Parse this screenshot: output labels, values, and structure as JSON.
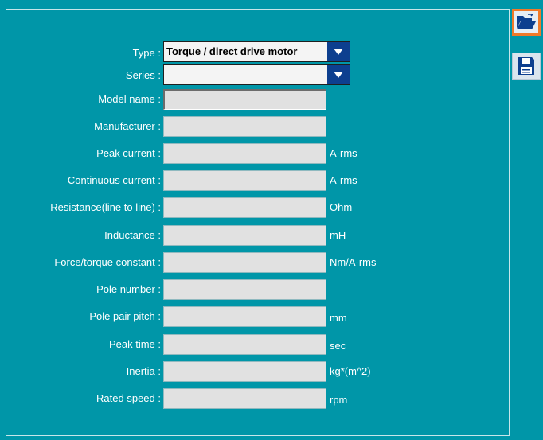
{
  "form": {
    "type": {
      "label": "Type :",
      "value": "Torque / direct drive motor"
    },
    "series": {
      "label": "Series :",
      "value": ""
    },
    "fields": [
      {
        "key": "model_name",
        "label": "Model name :",
        "value": "",
        "unit": ""
      },
      {
        "key": "manufacturer",
        "label": "Manufacturer :",
        "value": "",
        "unit": ""
      },
      {
        "key": "peak_current",
        "label": "Peak current :",
        "value": "",
        "unit": "A-rms"
      },
      {
        "key": "continuous_current",
        "label": "Continuous current :",
        "value": "",
        "unit": "A-rms"
      },
      {
        "key": "resistance",
        "label": "Resistance(line to line) :",
        "value": "",
        "unit": "Ohm"
      },
      {
        "key": "inductance",
        "label": "Inductance :",
        "value": "",
        "unit": "mH"
      },
      {
        "key": "torque_constant",
        "label": "Force/torque constant :",
        "value": "",
        "unit": "Nm/A-rms"
      },
      {
        "key": "pole_number",
        "label": "Pole number :",
        "value": "",
        "unit": ""
      },
      {
        "key": "pole_pair_pitch",
        "label": "Pole pair pitch :",
        "value": "",
        "unit": "mm"
      },
      {
        "key": "peak_time",
        "label": "Peak time :",
        "value": "",
        "unit": "sec"
      },
      {
        "key": "inertia",
        "label": "Inertia :",
        "value": "",
        "unit": "kg*(m^2)"
      },
      {
        "key": "rated_speed",
        "label": "Rated speed :",
        "value": "",
        "unit": "rpm"
      }
    ]
  },
  "toolbar": {
    "open_icon": "folder-open-icon",
    "save_icon": "floppy-save-icon"
  },
  "colors": {
    "background": "#0096a8",
    "dropdown_arrow": "#0d3f8f",
    "highlight": "#f07a2a",
    "field_bg": "#e1e1e1"
  }
}
